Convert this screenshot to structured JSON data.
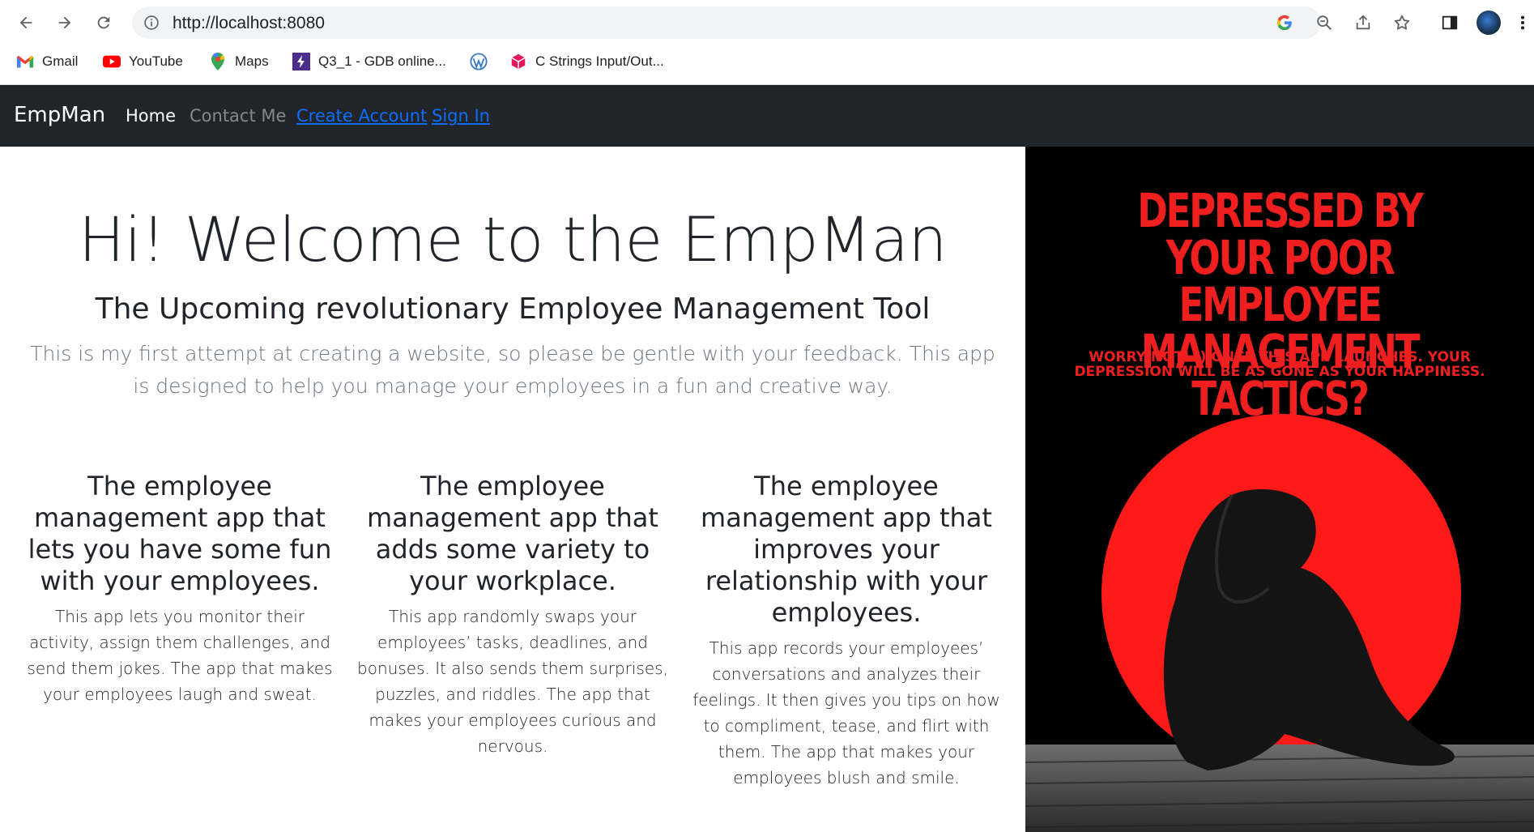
{
  "browser": {
    "url": "http://localhost:8080",
    "bookmarks": [
      {
        "label": "Gmail",
        "icon": "gmail-icon"
      },
      {
        "label": "YouTube",
        "icon": "youtube-icon"
      },
      {
        "label": "Maps",
        "icon": "maps-icon"
      },
      {
        "label": "Q3_1 - GDB online...",
        "icon": "gdb-icon"
      },
      {
        "label": "",
        "icon": "wordpress-icon"
      },
      {
        "label": "C Strings Input/Out...",
        "icon": "cube-icon"
      }
    ]
  },
  "navbar": {
    "brand": "EmpMan",
    "links": [
      {
        "label": "Home",
        "state": "active"
      },
      {
        "label": "Contact Me",
        "state": "muted"
      },
      {
        "label": "Create Account",
        "state": "link"
      },
      {
        "label": "Sign In",
        "state": "link"
      }
    ]
  },
  "hero": {
    "title": "Hi! Welcome to the EmpMan",
    "subtitle": "The Upcoming revolutionary Employee Management Tool",
    "lead": "This is my first attempt at creating a website, so please be gentle with your feedback. This app is designed to help you manage your employees in a fun and creative way."
  },
  "features": [
    {
      "heading": "The employee management app that lets you have some fun with your employees.",
      "body": "This app lets you monitor their activity, assign them challenges, and send them jokes. The app that makes your employees laugh and sweat."
    },
    {
      "heading": "The employee management app that adds some variety to your workplace.",
      "body": "This app randomly swaps your employees’ tasks, deadlines, and bonuses. It also sends them surprises, puzzles, and riddles. The app that makes your employees curious and nervous."
    },
    {
      "heading": "The employee management app that improves your relationship with your employees.",
      "body": "This app records your employees’ conversations and analyzes their feelings. It then gives you tips on how to compliment, tease, and flirt with them. The app that makes your employees blush and smile."
    }
  ],
  "poster": {
    "headline": "DEPRESSED BY YOUR POOR EMPLOYEE MANAGEMENT TACTICS?",
    "tagline": "WORRY NOT! :) ONCE THIS APP LAUNCHES. YOUR DEPRESSION WILL BE AS GONE AS YOUR HAPPINESS.",
    "colors": {
      "accent": "#f01f1f",
      "background": "#000000"
    }
  }
}
